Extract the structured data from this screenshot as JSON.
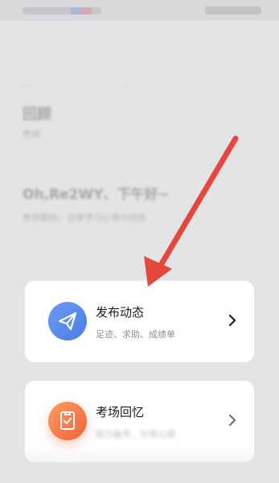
{
  "cards": [
    {
      "title": "发布动态",
      "subtitle": "足迹、求助、成绩单",
      "icon": "send-icon",
      "color": "#5587ec"
    },
    {
      "title": "考场回忆",
      "subtitle": "助力备考、分享心得",
      "icon": "note-icon",
      "color": "#f5733f"
    }
  ],
  "annotation": {
    "color": "#e5473d"
  },
  "background": {
    "nav_label": "…",
    "nav_label_2": "…",
    "title": "回顾",
    "subtitle": "考研",
    "greeting": "Oh,Re2WY、下午好~",
    "desc": "考研期间，记录学习心得与动态"
  }
}
